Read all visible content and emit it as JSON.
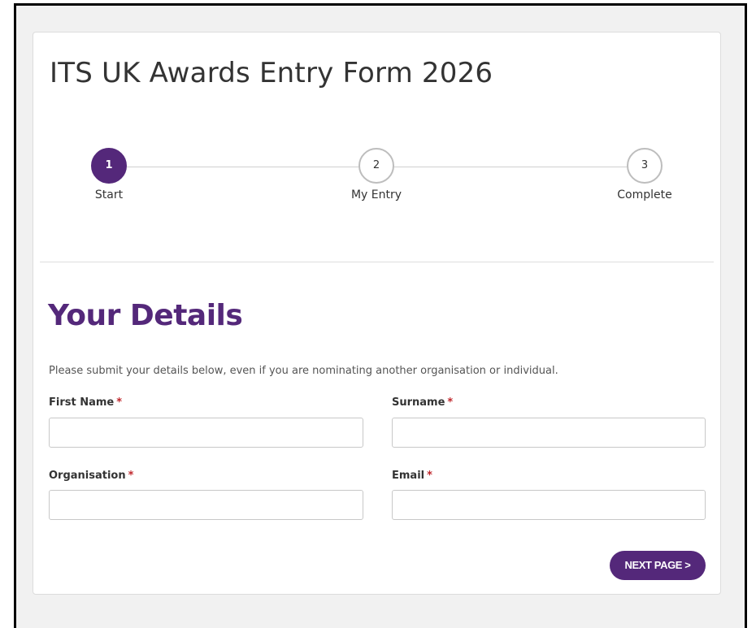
{
  "form": {
    "title": "ITS UK Awards Entry Form 2026"
  },
  "progress": {
    "steps": [
      {
        "number": "1",
        "label": "Start",
        "active": true
      },
      {
        "number": "2",
        "label": "My Entry",
        "active": false
      },
      {
        "number": "3",
        "label": "Complete",
        "active": false
      }
    ]
  },
  "section": {
    "title": "Your Details",
    "intro": "Please submit your details below, even if you are nominating another organisation or individual."
  },
  "fields": {
    "first_name": {
      "label": "First Name",
      "required": "*",
      "value": "",
      "placeholder": ""
    },
    "surname": {
      "label": "Surname",
      "required": "*",
      "value": "",
      "placeholder": ""
    },
    "organisation": {
      "label": "Organisation",
      "required": "*",
      "value": "",
      "placeholder": ""
    },
    "email": {
      "label": "Email",
      "required": "*",
      "value": "",
      "placeholder": ""
    }
  },
  "actions": {
    "next_label": "NEXT PAGE >"
  },
  "colors": {
    "accent": "#54287a",
    "required": "#c0282d",
    "background": "#f1f1f1"
  }
}
